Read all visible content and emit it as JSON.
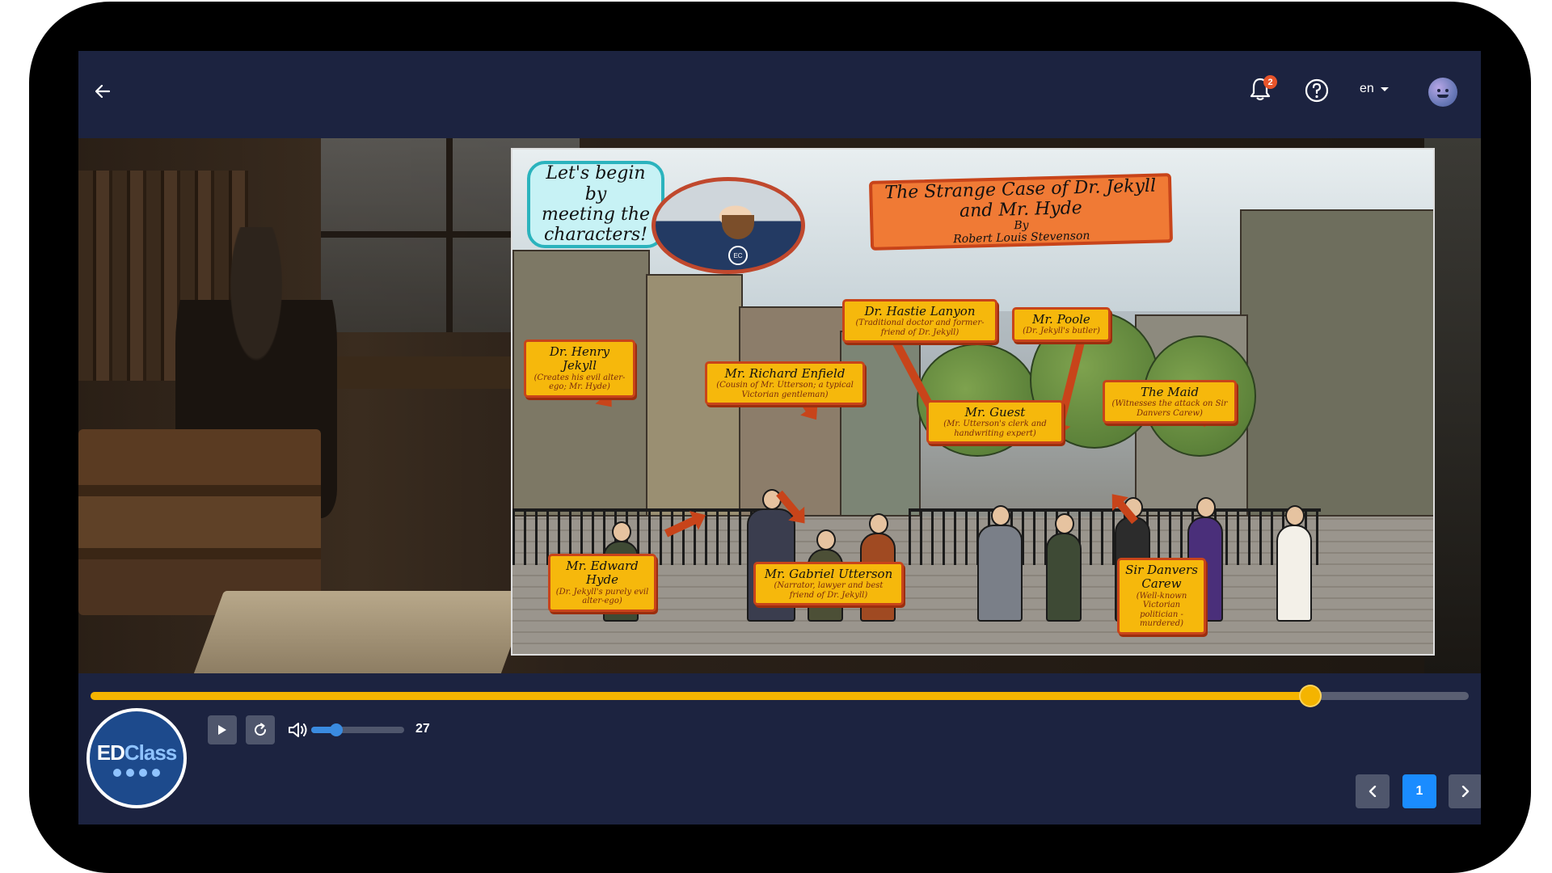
{
  "topbar": {
    "notifications_count": "2",
    "language": "en",
    "icons": [
      "back-arrow-icon",
      "bell-icon",
      "help-icon",
      "chevron-down-icon",
      "user-avatar"
    ]
  },
  "slide": {
    "speech": "Let's begin by\nmeeting the\ncharacters!",
    "host_logo": "EC",
    "title": "The Strange Case of Dr. Jekyll and Mr. Hyde",
    "by": "By",
    "author": "Robert Louis Stevenson",
    "characters": [
      {
        "name": "Dr. Henry Jekyll",
        "desc": "(Creates his evil alter-ego; Mr. Hyde)"
      },
      {
        "name": "Mr. Richard Enfield",
        "desc": "(Cousin of Mr. Utterson; a typical Victorian gentleman)"
      },
      {
        "name": "Dr. Hastie Lanyon",
        "desc": "(Traditional doctor and former-friend of Dr. Jekyll)"
      },
      {
        "name": "Mr. Poole",
        "desc": "(Dr. Jekyll's butler)"
      },
      {
        "name": "Mr. Guest",
        "desc": "(Mr. Utterson's clerk and handwriting expert)"
      },
      {
        "name": "The Maid",
        "desc": "(Witnesses the attack on Sir Danvers Carew)"
      },
      {
        "name": "Mr. Edward Hyde",
        "desc": "(Dr. Jekyll's purely evil alter-ego)"
      },
      {
        "name": "Mr. Gabriel Utterson",
        "desc": "(Narrator, lawyer and best friend of Dr. Jekyll)"
      },
      {
        "name": "Sir Danvers Carew",
        "desc": "(Well-known Victorian politician - murdered)"
      }
    ]
  },
  "player": {
    "progress": 0.885,
    "volume_level": 0.27,
    "volume_value": "27",
    "brand": {
      "ed": "ED",
      "class": "Class"
    },
    "page_current": "1",
    "colors": {
      "progress": "#f4b400",
      "volume": "#3a8be0",
      "page_active": "#1a8cff",
      "page_nav": "#4f566c"
    }
  }
}
